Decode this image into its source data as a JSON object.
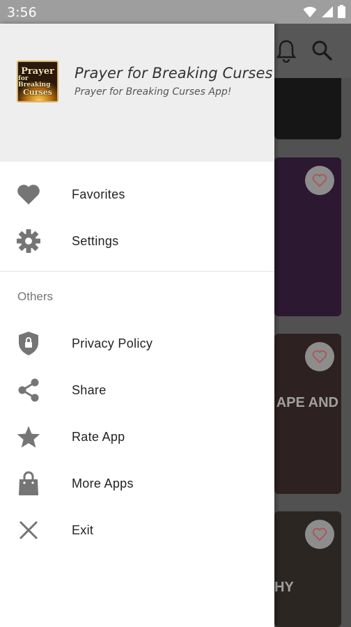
{
  "status_bar": {
    "time": "3:56",
    "icons": [
      "wifi-icon",
      "signal-icon",
      "battery-icon"
    ]
  },
  "drawer": {
    "header": {
      "logo_lines": [
        "Prayer",
        "for Breaking",
        "Curses"
      ],
      "title": "Prayer for Breaking Curses",
      "subtitle": "Prayer for Breaking Curses App!"
    },
    "main_items": [
      {
        "label": "Favorites",
        "icon": "heart-icon"
      },
      {
        "label": "Settings",
        "icon": "gear-icon"
      }
    ],
    "others_section": {
      "title": "Others",
      "items": [
        {
          "label": "Privacy Policy",
          "icon": "shield-lock-icon"
        },
        {
          "label": "Share",
          "icon": "share-icon"
        },
        {
          "label": "Rate App",
          "icon": "star-icon"
        },
        {
          "label": "More Apps",
          "icon": "shopping-bag-icon"
        },
        {
          "label": "Exit",
          "icon": "close-icon"
        }
      ]
    }
  },
  "background": {
    "toolbar_icons": [
      "bell-icon",
      "search-icon"
    ],
    "card_texts": [
      "APE AND",
      "HY"
    ]
  },
  "colors": {
    "icon_gray": "#757575",
    "header_bg": "#eeeeee",
    "status_bar_bg": "#9e9e9e",
    "heart_outline": "#e57373"
  }
}
